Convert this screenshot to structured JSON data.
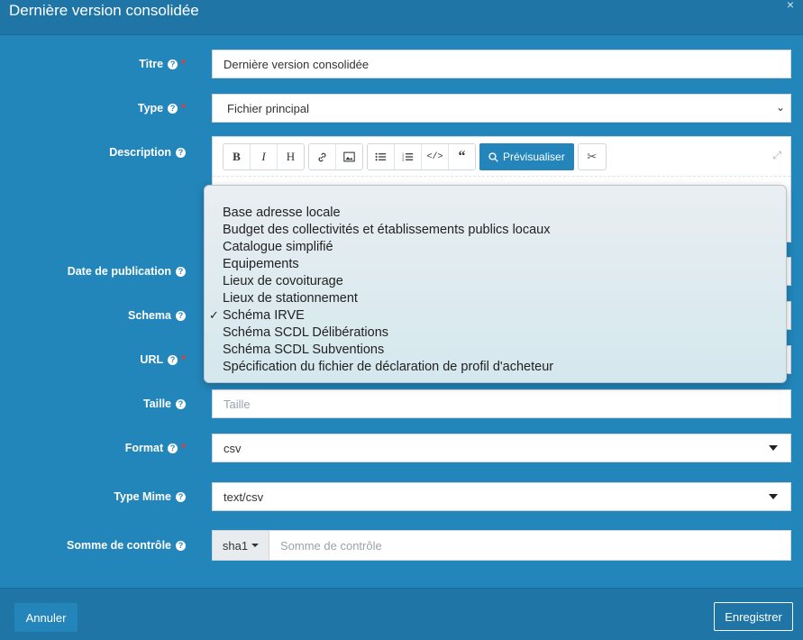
{
  "dialog": {
    "title": "Dernière version consolidée",
    "close_glyph": "×"
  },
  "form": {
    "titre": {
      "label": "Titre",
      "value": "Dernière version consolidée"
    },
    "type": {
      "label": "Type",
      "value": "Fichier principal"
    },
    "description": {
      "label": "Description"
    },
    "date": {
      "label": "Date de publication"
    },
    "schema": {
      "label": "Schema"
    },
    "url": {
      "label": "URL"
    },
    "taille": {
      "label": "Taille",
      "placeholder": "Taille"
    },
    "format": {
      "label": "Format",
      "value": "csv"
    },
    "mime": {
      "label": "Type Mime",
      "value": "text/csv"
    },
    "checksum": {
      "label": "Somme de contrôle",
      "algo": "sha1",
      "placeholder": "Somme de contrôle"
    }
  },
  "editor": {
    "buttons": [
      "B",
      "I",
      "H",
      "link",
      "image",
      "bullet-list",
      "numbered-list",
      "code",
      "quote"
    ],
    "preview_label": "Prévisualiser"
  },
  "schema_options": [
    "Base adresse locale",
    "Budget des collectivités et établissements publics locaux",
    "Catalogue simplifié",
    "Equipements",
    "Lieux de covoiturage",
    "Lieux de stationnement",
    "Schéma IRVE",
    "Schéma SCDL Délibérations",
    "Schéma SCDL Subventions",
    "Spécification du fichier de déclaration de profil d'acheteur"
  ],
  "schema_selected": "Schéma IRVE",
  "footer": {
    "cancel": "Annuler",
    "save": "Enregistrer"
  }
}
